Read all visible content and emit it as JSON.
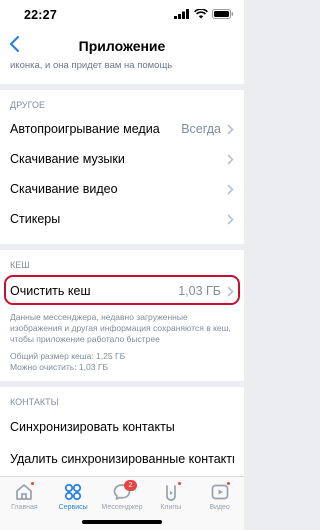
{
  "status_bar": {
    "time": "22:27"
  },
  "nav": {
    "title": "Приложение"
  },
  "top_text": "иконка, и она придет вам на помощь",
  "sections": {
    "other": {
      "header": "ДРУГОЕ",
      "autoplay": {
        "label": "Автопроигрывание медиа",
        "value": "Всегда"
      },
      "music": {
        "label": "Скачивание музыки"
      },
      "video": {
        "label": "Скачивание видео"
      },
      "stickers": {
        "label": "Стикеры"
      }
    },
    "cache": {
      "header": "КЕШ",
      "clear": {
        "label": "Очистить кеш",
        "value": "1,03 ГБ"
      },
      "description": "Данные мессенджера, недавно загруженные изображения и другая информация сохраняются в кеш, чтобы приложение работало быстрее",
      "total": "Общий размер кеша: 1,25 ГБ",
      "clearable": "Можно очистить: 1,03 ГБ"
    },
    "contacts": {
      "header": "КОНТАКТЫ",
      "sync": {
        "label": "Синхронизировать контакты"
      },
      "delete_sync": {
        "label": "Удалить синхронизированные контакты"
      }
    }
  },
  "tabbar": {
    "home": "Главная",
    "services": "Сервисы",
    "messenger": "Мессенджер",
    "messenger_badge": "2",
    "clips": "Клипы",
    "video": "Видео"
  },
  "colors": {
    "accent": "#2d81e0",
    "highlight": "#c8102e",
    "secondary": "#818c99"
  }
}
